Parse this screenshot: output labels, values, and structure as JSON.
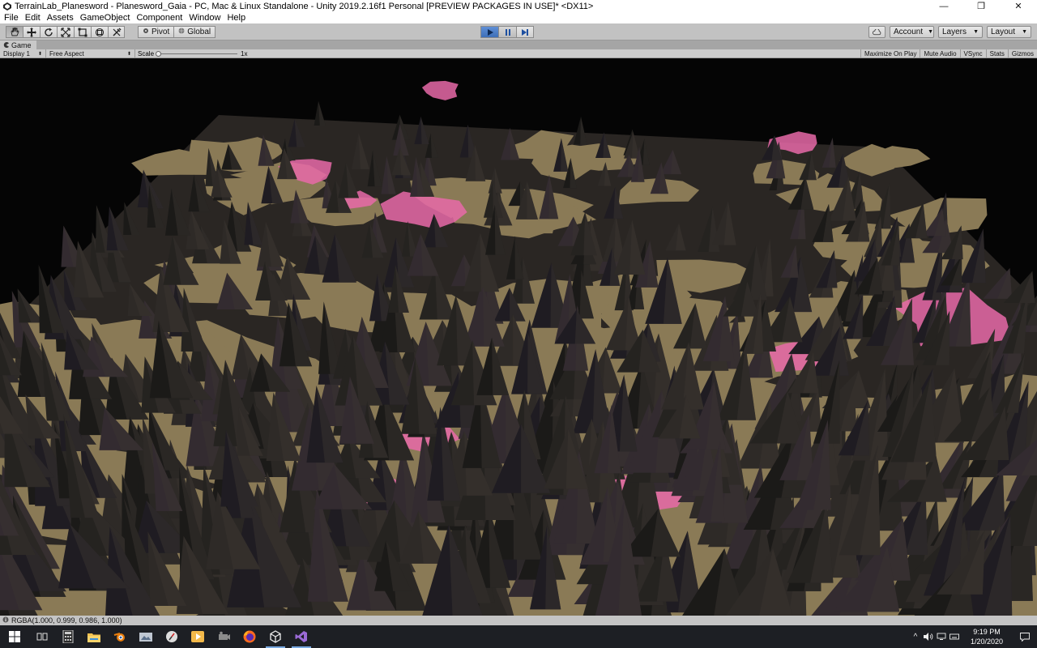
{
  "window": {
    "title": "TerrainLab_Planesword - Planesword_Gaia - PC, Mac & Linux Standalone - Unity 2019.2.16f1 Personal [PREVIEW PACKAGES IN USE]* <DX11>",
    "minimize_glyph": "—",
    "maximize_glyph": "❐",
    "close_glyph": "✕"
  },
  "menu": [
    "File",
    "Edit",
    "Assets",
    "GameObject",
    "Component",
    "Window",
    "Help"
  ],
  "toolbar": {
    "pivot_label": "Pivot",
    "global_label": "Global",
    "account_label": "Account",
    "layers_label": "Layers",
    "layout_label": "Layout"
  },
  "game_tab": {
    "label": "Game"
  },
  "game_toolbar": {
    "display": "Display 1",
    "aspect": "Free Aspect",
    "scale_label": "Scale",
    "scale_value": "1x",
    "maximize_on_play": "Maximize On Play",
    "mute_audio": "Mute Audio",
    "vsync": "VSync",
    "stats": "Stats",
    "gizmos": "Gizmos"
  },
  "status": {
    "text": "RGBA(1.000, 0.999, 0.986, 1.000)"
  },
  "taskbar": {
    "apps": [
      "start",
      "task-view",
      "calculator",
      "file-explorer",
      "blender",
      "photos",
      "clock-app",
      "media-player",
      "capture",
      "firefox",
      "unity",
      "visual-studio"
    ],
    "active": [
      "unity",
      "visual-studio"
    ]
  },
  "clock": {
    "time": "9:19 PM",
    "date": "1/20/2020"
  },
  "colors": {
    "lava": "#ff8a2a",
    "rock": "#1e1d1b",
    "pink": "#e86aa8",
    "sand": "#8a7a56",
    "play_active": "#4a7bc4"
  }
}
